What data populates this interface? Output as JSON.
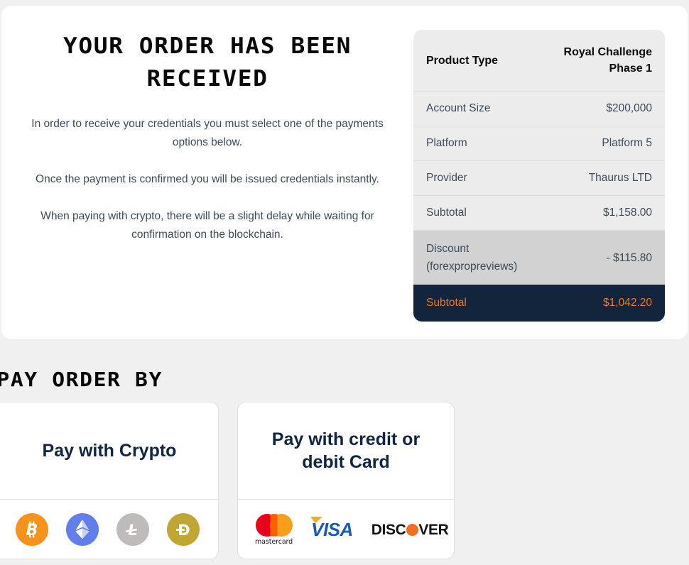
{
  "order": {
    "title": "YOUR ORDER HAS BEEN RECEIVED",
    "paragraphs": [
      "In order to receive your credentials you must select one of the payments options below.",
      "Once the payment is confirmed you will be issued credentials instantly.",
      "When paying with crypto, there will be a slight delay while waiting for confirmation on the blockchain."
    ]
  },
  "summary": {
    "header": {
      "label": "Product Type",
      "value": "Royal Challenge Phase 1"
    },
    "rows": [
      {
        "label": "Account Size",
        "value": "$200,000"
      },
      {
        "label": "Platform",
        "value": "Platform 5"
      },
      {
        "label": "Provider",
        "value": "Thaurus LTD"
      },
      {
        "label": "Subtotal",
        "value": "$1,158.00"
      }
    ],
    "discount": {
      "label": "Discount (forexpropreviews)",
      "value": "- $115.80"
    },
    "total": {
      "label": "Subtotal",
      "value": "$1,042.20"
    }
  },
  "pay_section": {
    "heading": "PAY ORDER BY",
    "options": [
      {
        "title": "Pay with Crypto",
        "logos": [
          {
            "name": "bitcoin-icon",
            "label": "Bitcoin",
            "color": "#f7931a"
          },
          {
            "name": "ethereum-icon",
            "label": "Ethereum",
            "color": "#627eea"
          },
          {
            "name": "litecoin-icon",
            "label": "Litecoin",
            "color": "#bfbbbb"
          },
          {
            "name": "dogecoin-icon",
            "label": "Dogecoin",
            "color": "#c2a633"
          }
        ]
      },
      {
        "title": "Pay with credit or debit Card",
        "logos": [
          {
            "name": "mastercard-icon",
            "label": "mastercard"
          },
          {
            "name": "visa-icon",
            "label": "VISA"
          },
          {
            "name": "discover-icon",
            "label": "DISCOVER"
          }
        ]
      }
    ]
  },
  "colors": {
    "page_background": "#f0f0f0",
    "card_background": "#ffffff",
    "navy": "#12253d",
    "accent_orange": "#f07a1a",
    "table_row": "#ececec",
    "table_discount_row": "#d2d2d2",
    "body_text": "#3e4a5a"
  },
  "logo_words": {
    "mastercard": "mastercard",
    "visa": "VISA",
    "discover_pre": "DISC",
    "discover_post": "VER"
  }
}
